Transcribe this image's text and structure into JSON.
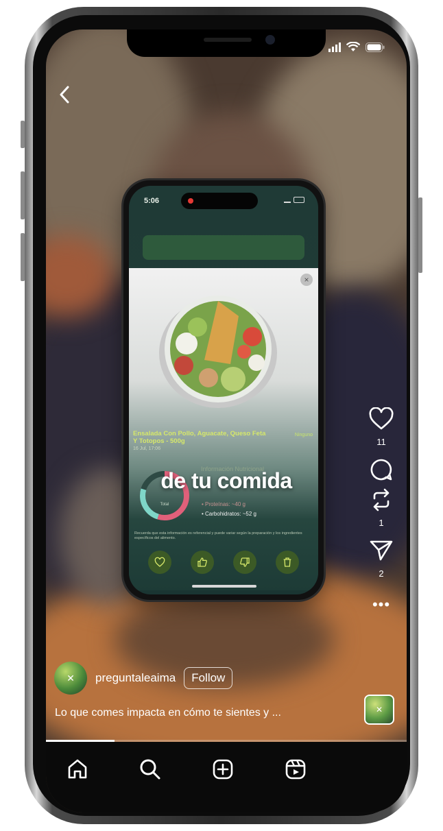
{
  "video": {
    "overlay_text": "de tu comida",
    "progress": 0.19
  },
  "inner_app": {
    "status_time": "5:06",
    "food_title": "Ensalada Con Pollo, Aguacate, Queso Feta Y Totopos - 500g",
    "food_date": "16 Jul, 17:06",
    "tag": "Ninguno",
    "section_title": "Información Nutricional",
    "macro_protein": "• Proteínas: ~40 g",
    "macro_carbs": "• Carbohidratos: ~52 g",
    "disclaimer": "Recuerda que esta información es referencial y puede variar según la preparación y los ingredientes específicos del alimento.",
    "donut_label": "Total",
    "colors": {
      "bar": "#2e5a3c",
      "title": "#d6e86a",
      "action": "#3c5a26"
    }
  },
  "actions": {
    "like_count": "11",
    "comment_count": "",
    "repost_count": "1",
    "share_count": "2",
    "icons": [
      "heart-icon",
      "comment-icon",
      "repost-icon",
      "send-icon",
      "more-icon"
    ]
  },
  "post": {
    "username": "preguntaleaima",
    "follow_label": "Follow",
    "caption": "Lo que comes impacta en cómo te sientes y ..."
  },
  "nav": {
    "icons": [
      "home-icon",
      "search-icon",
      "create-icon",
      "reels-icon"
    ]
  }
}
